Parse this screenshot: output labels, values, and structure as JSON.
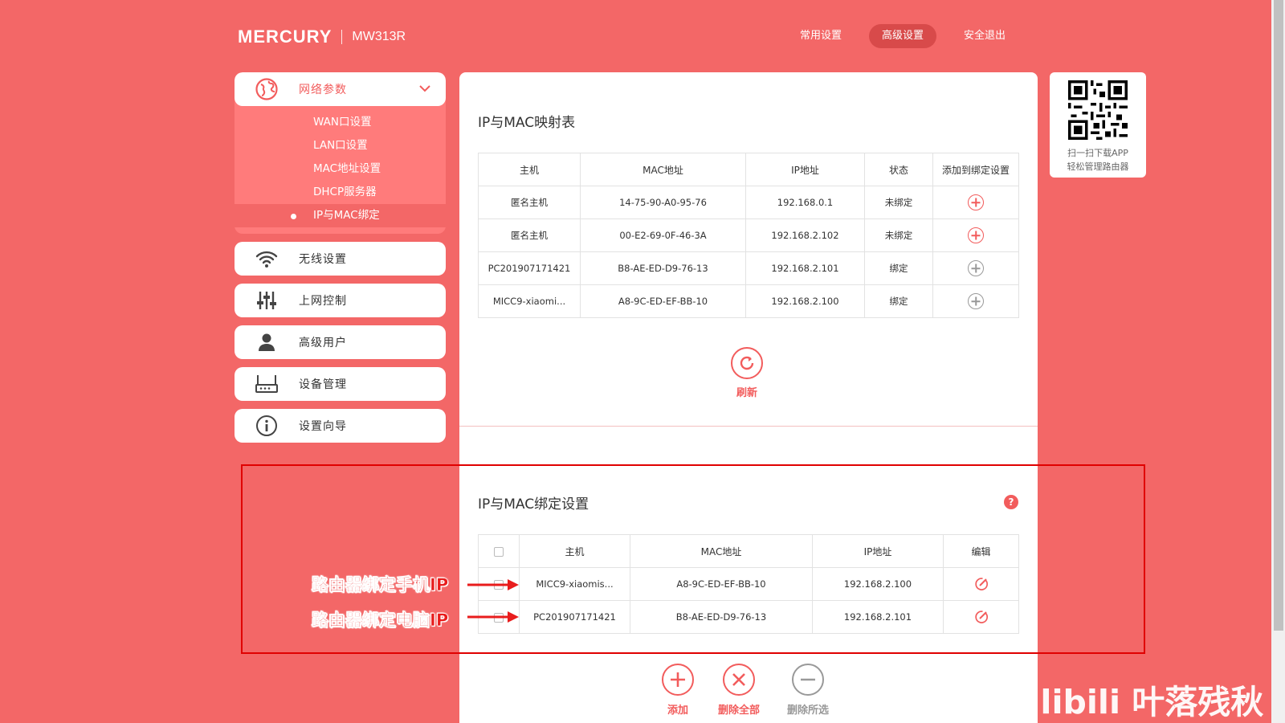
{
  "header": {
    "brand": "MERCURY",
    "model": "MW313R",
    "nav": [
      {
        "label": "常用设置",
        "active": false
      },
      {
        "label": "高级设置",
        "active": true
      },
      {
        "label": "安全退出",
        "active": false
      }
    ]
  },
  "sidebar": {
    "group": {
      "label": "网络参数",
      "icon": "globe-icon",
      "items": [
        {
          "label": "WAN口设置"
        },
        {
          "label": "LAN口设置"
        },
        {
          "label": "MAC地址设置"
        },
        {
          "label": "DHCP服务器"
        },
        {
          "label": "IP与MAC绑定",
          "active": true
        }
      ]
    },
    "items": [
      {
        "label": "无线设置",
        "icon": "wifi-icon"
      },
      {
        "label": "上网控制",
        "icon": "sliders-icon"
      },
      {
        "label": "高级用户",
        "icon": "user-icon"
      },
      {
        "label": "设备管理",
        "icon": "router-icon"
      },
      {
        "label": "设置向导",
        "icon": "info-icon"
      }
    ]
  },
  "mapping": {
    "title": "IP与MAC映射表",
    "columns": [
      "主机",
      "MAC地址",
      "IP地址",
      "状态",
      "添加到绑定设置"
    ],
    "rows": [
      {
        "host": "匿名主机",
        "mac": "14-75-90-A0-95-76",
        "ip": "192.168.0.1",
        "status": "未绑定",
        "bound": false
      },
      {
        "host": "匿名主机",
        "mac": "00-E2-69-0F-46-3A",
        "ip": "192.168.2.102",
        "status": "未绑定",
        "bound": false
      },
      {
        "host": "PC201907171421",
        "mac": "B8-AE-ED-D9-76-13",
        "ip": "192.168.2.101",
        "status": "绑定",
        "bound": true
      },
      {
        "host": "MICC9-xiaomi...",
        "mac": "A8-9C-ED-EF-BB-10",
        "ip": "192.168.2.100",
        "status": "绑定",
        "bound": true
      }
    ],
    "refresh_label": "刷新"
  },
  "binding": {
    "title": "IP与MAC绑定设置",
    "help": "?",
    "columns": [
      "主机",
      "MAC地址",
      "IP地址",
      "编辑"
    ],
    "rows": [
      {
        "host": "MICC9-xiaomis...",
        "mac": "A8-9C-ED-EF-BB-10",
        "ip": "192.168.2.100"
      },
      {
        "host": "PC201907171421",
        "mac": "B8-AE-ED-D9-76-13",
        "ip": "192.168.2.101"
      }
    ],
    "actions": {
      "add": "添加",
      "delete_all": "删除全部",
      "delete_selected": "删除所选"
    }
  },
  "qr": {
    "line1": "扫一扫下载APP",
    "line2": "轻松管理路由器"
  },
  "annotations": {
    "phone": "路由器绑定手机IP",
    "pc": "路由器绑定电脑IP"
  },
  "watermark": "bilibili 叶落残秋",
  "colors": {
    "background": "#f36767",
    "accent": "#f25c5c",
    "annotation": "#e81c1c"
  }
}
